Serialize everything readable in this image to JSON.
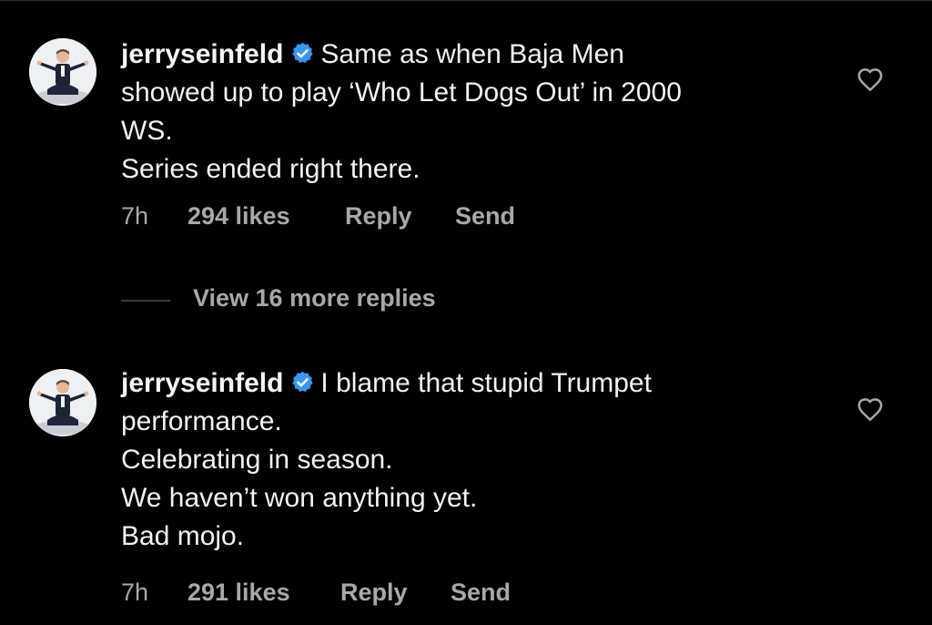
{
  "comments": [
    {
      "username": "jerryseinfeld",
      "verified": true,
      "text_lines": [
        "Same as when Baja Men",
        "showed up to play ‘Who Let Dogs Out’ in 2000",
        "WS.",
        "Series ended right there."
      ],
      "time": "7h",
      "likes": "294 likes",
      "reply_label": "Reply",
      "send_label": "Send"
    },
    {
      "username": "jerryseinfeld",
      "verified": true,
      "text_lines": [
        "I blame that stupid Trumpet",
        "performance.",
        "Celebrating in season.",
        "We haven’t won anything yet.",
        "Bad mojo."
      ],
      "time": "7h",
      "likes": "291 likes",
      "reply_label": "Reply",
      "send_label": "Send"
    }
  ],
  "view_more_replies": "View 16 more replies",
  "colors": {
    "background": "#000000",
    "text": "#f2f2f2",
    "secondary_text": "#a8a8a8",
    "verified_badge": "#3897f0"
  },
  "icons": {
    "verified": "verified-badge-icon",
    "like": "heart-outline-icon",
    "avatar": "profile-photo"
  }
}
